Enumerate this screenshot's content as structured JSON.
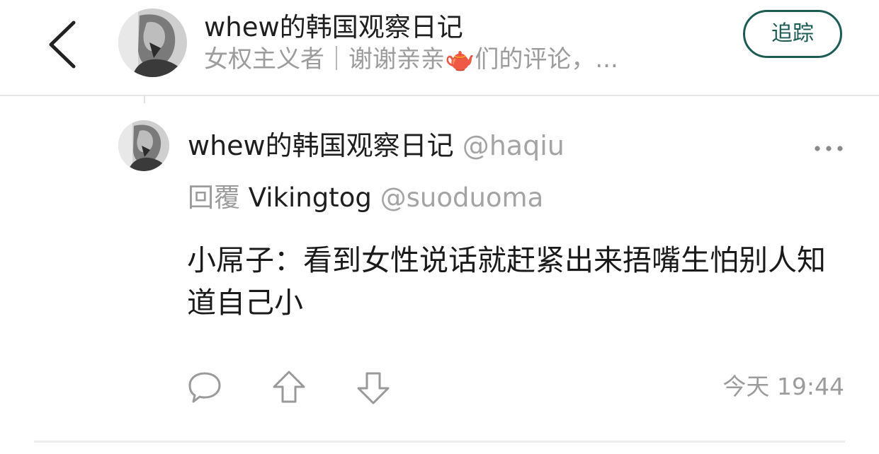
{
  "header": {
    "title": "whew的韩国观察日记",
    "subtitle": "女权主义者｜谢谢亲亲🫖们的评论，...",
    "follow_label": "追踪"
  },
  "post": {
    "author_name": "whew的韩国观察日记",
    "author_handle": "@haqiu",
    "reply_label": "回覆",
    "reply_to_name": "Vikingtog",
    "reply_to_handle": "@suoduoma",
    "body": "小屌子：看到女性说话就赶紧出来捂嘴生怕别人知道自己小",
    "time": "今天 19:44"
  },
  "icons": {
    "back": "chevron-left-icon",
    "more": "more-horizontal-icon",
    "comment": "comment-bubble-icon",
    "upvote": "upvote-arrow-icon",
    "downvote": "downvote-arrow-icon"
  },
  "colors": {
    "accent": "#1d5c55",
    "secondary_text": "#9c9c9c",
    "divider": "#ececec"
  }
}
